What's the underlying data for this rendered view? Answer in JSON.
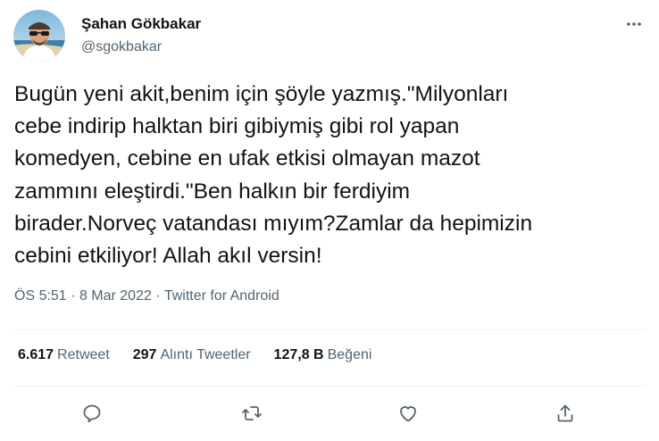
{
  "user": {
    "display_name": "Şahan Gökbakar",
    "handle": "@sgokbakar"
  },
  "tweet": {
    "lines": [
      "Bugün yeni akit,benim için şöyle yazmış.\"Milyonları",
      "cebe indirip halktan biri gibiymiş gibi rol yapan",
      "komedyen, cebine en ufak etkisi olmayan mazot",
      "zammını eleştirdi.\"Ben halkın bir ferdiyim",
      "birader.Norveç vatandası mıyım?Zamlar da hepimizin",
      "cebini etkiliyor! Allah akıl versin!"
    ]
  },
  "meta": {
    "time": "ÖS 5:51",
    "separator": "·",
    "date": "8 Mar 2022",
    "source": "Twitter for Android"
  },
  "stats": {
    "retweets_count": "6.617",
    "retweets_label": "Retweet",
    "quotes_count": "297",
    "quotes_label": "Alıntı Tweetler",
    "likes_count": "127,8 B",
    "likes_label": "Beğeni"
  },
  "actions": [
    "reply-icon",
    "retweet-icon",
    "like-icon",
    "share-icon"
  ],
  "colors": {
    "text": "#0f1419",
    "secondary": "#536471",
    "divider": "#eff3f4"
  }
}
